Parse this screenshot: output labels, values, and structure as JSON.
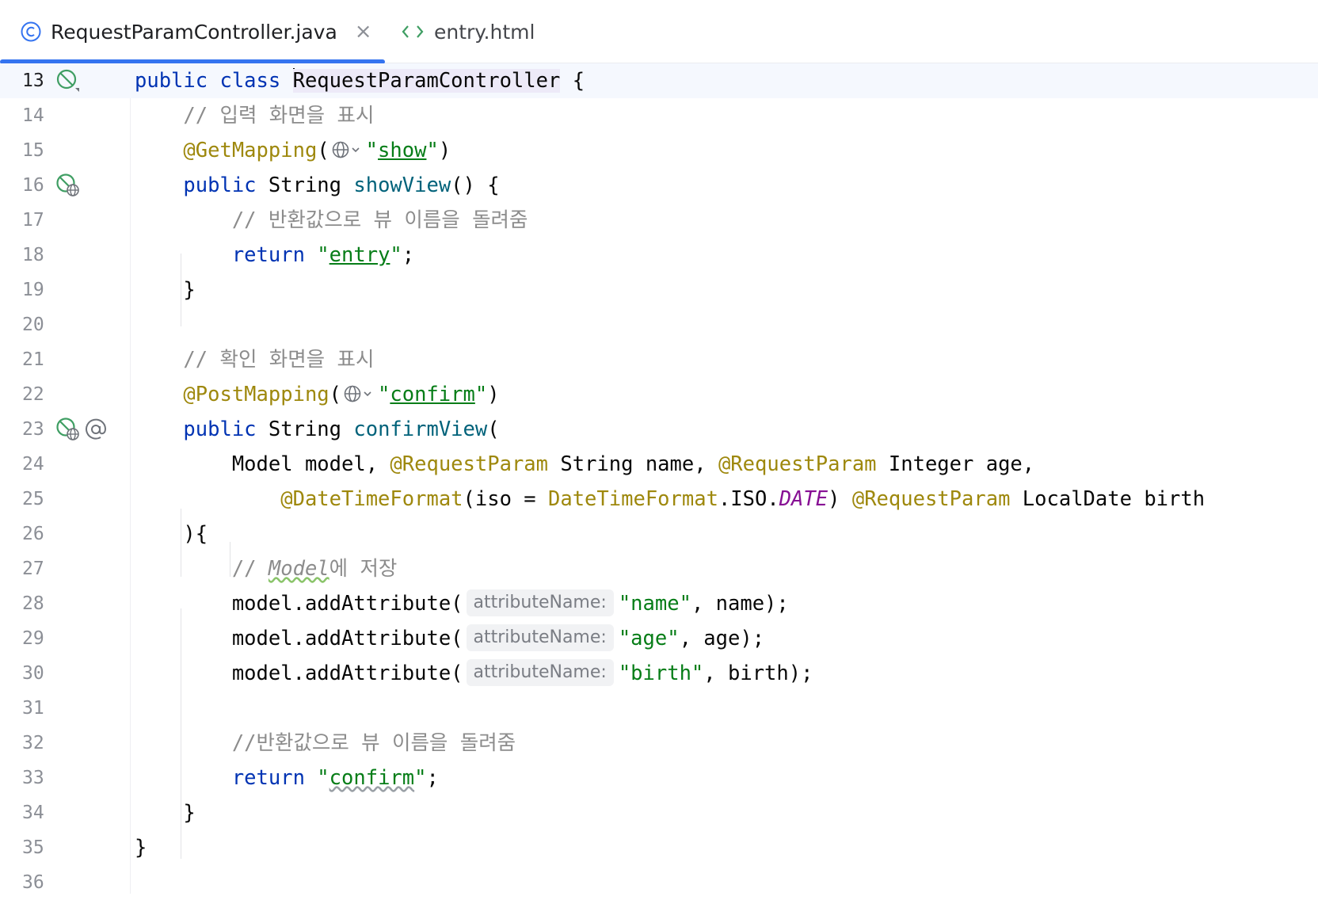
{
  "tabs": [
    {
      "label": "RequestParamController.java",
      "active": true,
      "icon": "class-icon",
      "closable": true
    },
    {
      "label": "entry.html",
      "active": false,
      "icon": "html-icon",
      "closable": false
    }
  ],
  "colors": {
    "accent": "#3574f0",
    "keyword": "#0033b3",
    "annotation": "#9e880d",
    "string": "#067d17",
    "comment": "#8c8c8c",
    "method": "#00627a",
    "static_field": "#871094"
  },
  "hints": {
    "attribute_name": "attributeName:"
  },
  "lines": {
    "13": {
      "num": "13",
      "kw": "public class ",
      "cls": "RequestParamController",
      "rest": " {"
    },
    "14": {
      "num": "14",
      "comment": "// 입력 화면을 표시"
    },
    "15": {
      "num": "15",
      "anno": "@GetMapping",
      "p1": "(",
      "q1": "\"",
      "str": "show",
      "q2": "\"",
      "p2": ")"
    },
    "16": {
      "num": "16",
      "kw": "public ",
      "type": "String ",
      "method": "showView",
      "rest": "() {"
    },
    "17": {
      "num": "17",
      "comment": "// 반환값으로 뷰 이름을 돌려줌"
    },
    "18": {
      "num": "18",
      "kw": "return ",
      "q1": "\"",
      "str": "entry",
      "q2": "\"",
      "rest": ";"
    },
    "19": {
      "num": "19",
      "text": "}"
    },
    "20": {
      "num": "20"
    },
    "21": {
      "num": "21",
      "comment": "// 확인 화면을 표시"
    },
    "22": {
      "num": "22",
      "anno": "@PostMapping",
      "p1": "(",
      "q1": "\"",
      "str": "confirm",
      "q2": "\"",
      "p2": ")"
    },
    "23": {
      "num": "23",
      "kw": "public ",
      "type": "String ",
      "method": "confirmView",
      "rest": "("
    },
    "24": {
      "num": "24",
      "t1": "Model model, ",
      "a1": "@RequestParam",
      "t2": " String name, ",
      "a2": "@RequestParam",
      "t3": " Integer age,"
    },
    "25": {
      "num": "25",
      "a1": "@DateTimeFormat",
      "t1": "(iso = ",
      "a2": "DateTimeFormat",
      "t2": ".ISO.",
      "stat": "DATE",
      "t3": ") ",
      "a3": "@RequestParam",
      "t4": " LocalDate birth"
    },
    "26": {
      "num": "26",
      "text": "){"
    },
    "27": {
      "num": "27",
      "c1": "// ",
      "c2": "Model",
      "c3": "에 저장"
    },
    "28": {
      "num": "28",
      "t1": "model.addAttribute(",
      "str": "\"name\"",
      "t2": ", name);"
    },
    "29": {
      "num": "29",
      "t1": "model.addAttribute(",
      "str": "\"age\"",
      "t2": ", age);"
    },
    "30": {
      "num": "30",
      "t1": "model.addAttribute(",
      "str": "\"birth\"",
      "t2": ", birth);"
    },
    "31": {
      "num": "31"
    },
    "32": {
      "num": "32",
      "comment": "//반환값으로 뷰 이름을 돌려줌"
    },
    "33": {
      "num": "33",
      "kw": "return ",
      "q1": "\"",
      "str": "confirm",
      "q2": "\"",
      "rest": ";"
    },
    "34": {
      "num": "34",
      "text": "}"
    },
    "35": {
      "num": "35",
      "text": "}"
    },
    "36": {
      "num": "36"
    }
  }
}
